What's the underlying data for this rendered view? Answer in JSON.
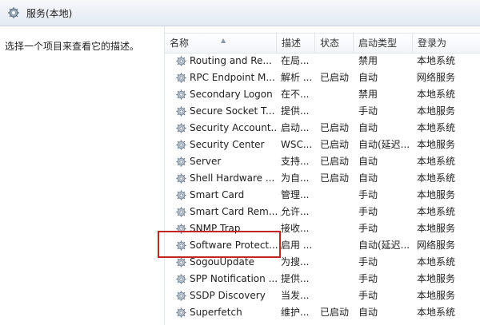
{
  "header": {
    "title": "服务(本地)",
    "icon": "services-icon"
  },
  "left_pane": {
    "description_hint": "选择一个项目来查看它的描述。"
  },
  "table": {
    "columns": [
      "名称",
      "描述",
      "状态",
      "启动类型",
      "登录为"
    ],
    "rows": [
      {
        "name": "Routing and Re...",
        "desc": "在局...",
        "status": "",
        "startup": "禁用",
        "logon": "本地系统"
      },
      {
        "name": "RPC Endpoint M...",
        "desc": "解析 ...",
        "status": "已启动",
        "startup": "自动",
        "logon": "网络服务"
      },
      {
        "name": "Secondary Logon",
        "desc": "在不...",
        "status": "",
        "startup": "禁用",
        "logon": "本地系统"
      },
      {
        "name": "Secure Socket T...",
        "desc": "提供...",
        "status": "",
        "startup": "手动",
        "logon": "本地服务"
      },
      {
        "name": "Security Account...",
        "desc": "启动...",
        "status": "已启动",
        "startup": "自动",
        "logon": "本地系统"
      },
      {
        "name": "Security Center",
        "desc": "WSC...",
        "status": "已启动",
        "startup": "自动(延迟...",
        "logon": "本地服务"
      },
      {
        "name": "Server",
        "desc": "支持...",
        "status": "已启动",
        "startup": "自动",
        "logon": "本地系统"
      },
      {
        "name": "Shell Hardware ...",
        "desc": "为自...",
        "status": "已启动",
        "startup": "自动",
        "logon": "本地系统"
      },
      {
        "name": "Smart Card",
        "desc": "管理...",
        "status": "",
        "startup": "手动",
        "logon": "本地服务"
      },
      {
        "name": "Smart Card Rem...",
        "desc": "允许...",
        "status": "",
        "startup": "手动",
        "logon": "本地系统"
      },
      {
        "name": "SNMP Trap",
        "desc": "接收...",
        "status": "",
        "startup": "手动",
        "logon": "本地服务"
      },
      {
        "name": "Software Protect...",
        "desc": "启用 ...",
        "status": "",
        "startup": "自动(延迟...",
        "logon": "网络服务"
      },
      {
        "name": "SogouUpdate",
        "desc": "为搜...",
        "status": "",
        "startup": "手动",
        "logon": "本地系统"
      },
      {
        "name": "SPP Notification ...",
        "desc": "提供...",
        "status": "",
        "startup": "手动",
        "logon": "本地服务"
      },
      {
        "name": "SSDP Discovery",
        "desc": "当发...",
        "status": "",
        "startup": "手动",
        "logon": "本地服务"
      },
      {
        "name": "Superfetch",
        "desc": "维护...",
        "status": "已启动",
        "startup": "自动",
        "logon": "本地系统"
      }
    ]
  },
  "highlight_color": "#c52424"
}
